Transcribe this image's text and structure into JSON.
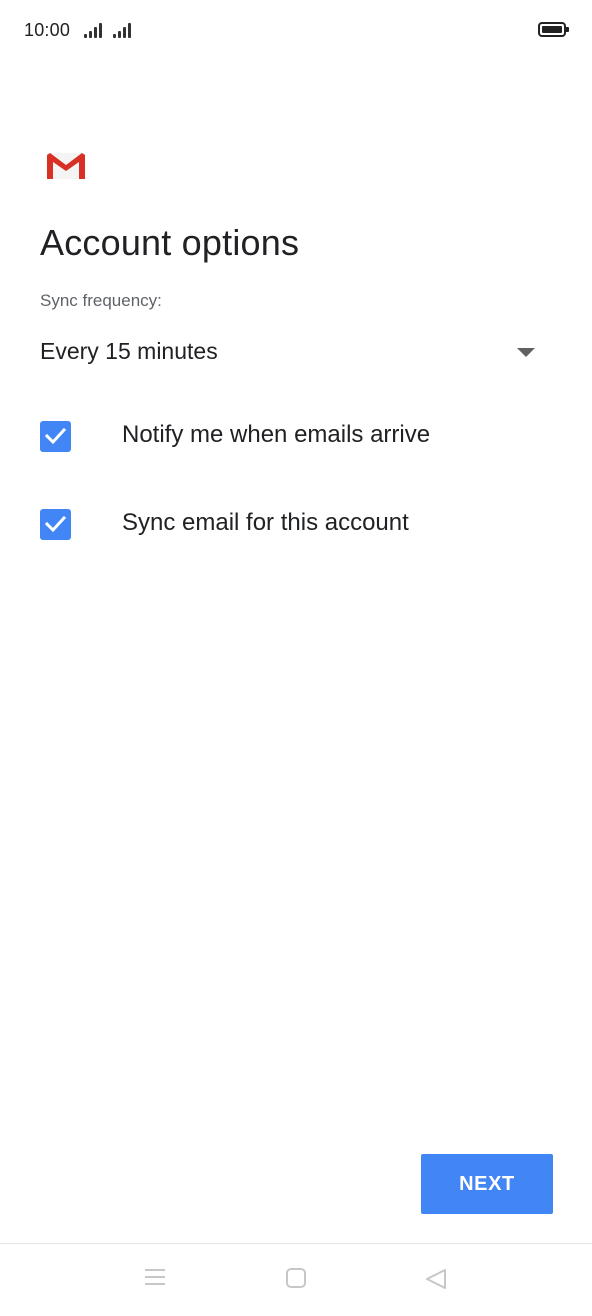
{
  "status_bar": {
    "time": "10:00",
    "icons": [
      "signal-icon",
      "signal-icon",
      "battery-icon"
    ]
  },
  "app": {
    "logo_icon": "gmail-logo-icon",
    "brand_color": "#d93025"
  },
  "page": {
    "title": "Account options"
  },
  "sync": {
    "label": "Sync frequency:",
    "value": "Every 15 minutes",
    "icon": "dropdown-arrow-icon"
  },
  "options": [
    {
      "label": "Notify me when emails arrive",
      "checked": true
    },
    {
      "label": "Sync email for this account",
      "checked": true
    }
  ],
  "actions": {
    "next_label": "NEXT"
  },
  "colors": {
    "accent": "#4285f4",
    "text": "#202124",
    "secondary_text": "#5f6368"
  },
  "nav_bar": {
    "icons": [
      "menu-icon",
      "home-icon",
      "back-icon"
    ]
  }
}
